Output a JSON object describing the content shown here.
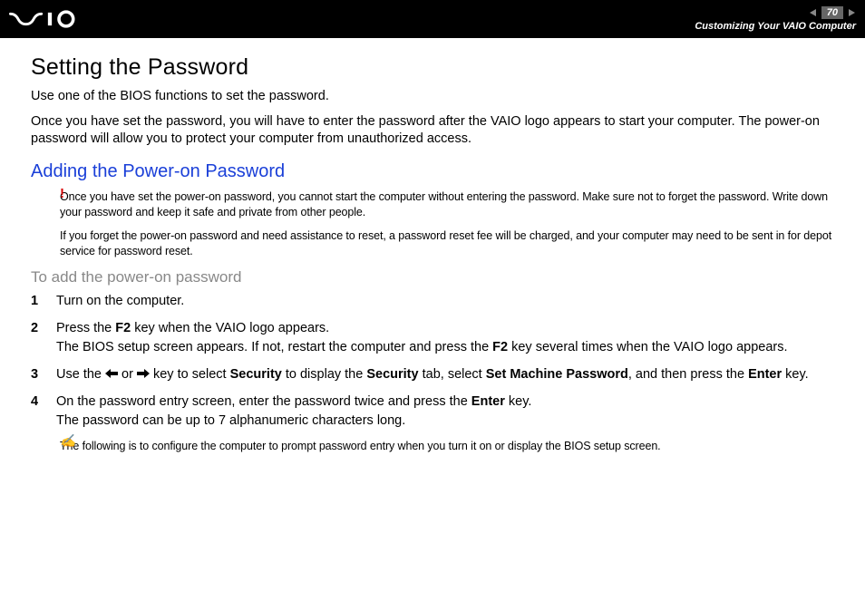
{
  "header": {
    "page_number": "70",
    "breadcrumb": "Customizing Your VAIO Computer"
  },
  "title": "Setting the Password",
  "intro1": "Use one of the BIOS functions to set the password.",
  "intro2": "Once you have set the password, you will have to enter the password after the VAIO logo appears to start your computer. The power-on password will allow you to protect your computer from unauthorized access.",
  "section_heading": "Adding the Power-on Password",
  "warning1": "Once you have set the power-on password, you cannot start the computer without entering the password. Make sure not to forget the password. Write down your password and keep it safe and private from other people.",
  "warning2": "If you forget the power-on password and need assistance to reset, a password reset fee will be charged, and your computer may need to be sent in for depot service for password reset.",
  "sub_heading": "To add the power-on password",
  "steps": [
    {
      "n": "1",
      "text": "Turn on the computer."
    },
    {
      "n": "2",
      "pre": "Press the ",
      "b1": "F2",
      "mid": " key when the VAIO logo appears.\nThe BIOS setup screen appears. If not, restart the computer and press the ",
      "b2": "F2",
      "post": " key several times when the VAIO logo appears."
    },
    {
      "n": "3",
      "pre": "Use the ",
      "mid1": " or ",
      "mid2": " key to select ",
      "b1": "Security",
      "mid3": " to display the ",
      "b2": "Security",
      "mid4": " tab, select ",
      "b3": "Set Machine Password",
      "mid5": ", and then press the ",
      "b4": "Enter",
      "post": " key."
    },
    {
      "n": "4",
      "pre": "On the password entry screen, enter the password twice and press the ",
      "b1": "Enter",
      "post": " key.\nThe password can be up to 7 alphanumeric characters long."
    }
  ],
  "tip": "The following is to configure the computer to prompt password entry when you turn it on or display the BIOS setup screen."
}
